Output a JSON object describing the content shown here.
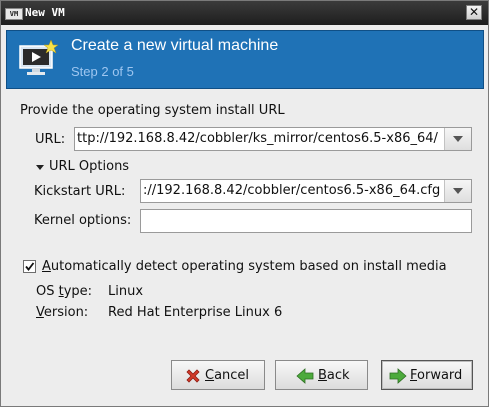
{
  "window": {
    "title": "New VM",
    "tb_icon": "VM",
    "close_glyph": "✕"
  },
  "header": {
    "title": "Create a new virtual machine",
    "step": "Step 2 of 5",
    "icon": "monitor-star-icon"
  },
  "section_heading": "Provide the operating system install URL",
  "url": {
    "label": "URL:",
    "value": "ttp://192.168.8.42/cobbler/ks_mirror/centos6.5-x86_64/"
  },
  "url_options": {
    "label": "URL Options",
    "kickstart_label": "Kickstart URL:",
    "kickstart_value": "://192.168.8.42/cobbler/centos6.5-x86_64.cfg",
    "kernel_label": "Kernel options:",
    "kernel_value": ""
  },
  "autodetect": {
    "checked": true,
    "label_first": "A",
    "label_rest": "utomatically detect operating system based on install media"
  },
  "os_info": {
    "type_label_pre": "OS ",
    "type_label_u": "t",
    "type_label_post": "ype:",
    "type_value": "Linux",
    "version_label_u": "V",
    "version_label_post": "ersion:",
    "version_value": "Red Hat Enterprise Linux 6"
  },
  "buttons": {
    "cancel_u": "C",
    "cancel_rest": "ancel",
    "back_u": "B",
    "back_rest": "ack",
    "forward_u": "F",
    "forward_rest": "orward"
  },
  "colors": {
    "header_bg": "#1f72b6",
    "step_text": "#9ec6f0",
    "cancel_icon": "#d23a2a",
    "nav_icon": "#4caa3c"
  }
}
